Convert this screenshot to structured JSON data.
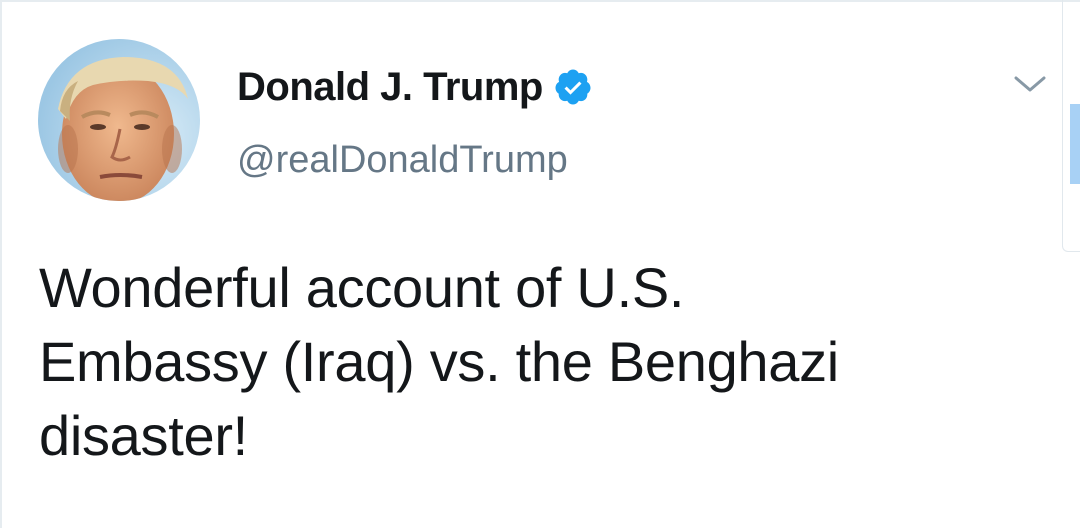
{
  "tweet": {
    "author": {
      "display_name": "Donald J. Trump",
      "handle": "@realDonaldTrump",
      "verified": true,
      "avatar_icon": "profile-photo"
    },
    "text_lines": [
      "Wonderful account of U.S.",
      "Embassy (Iraq) vs. the Benghazi",
      "disaster!"
    ],
    "menu_icon": "chevron-down-icon"
  },
  "colors": {
    "text": "#14171a",
    "handle": "#657786",
    "verified_badge": "#1da1f2",
    "chevron": "#8899a6",
    "scroll_thumb": "#a8d1f5"
  }
}
